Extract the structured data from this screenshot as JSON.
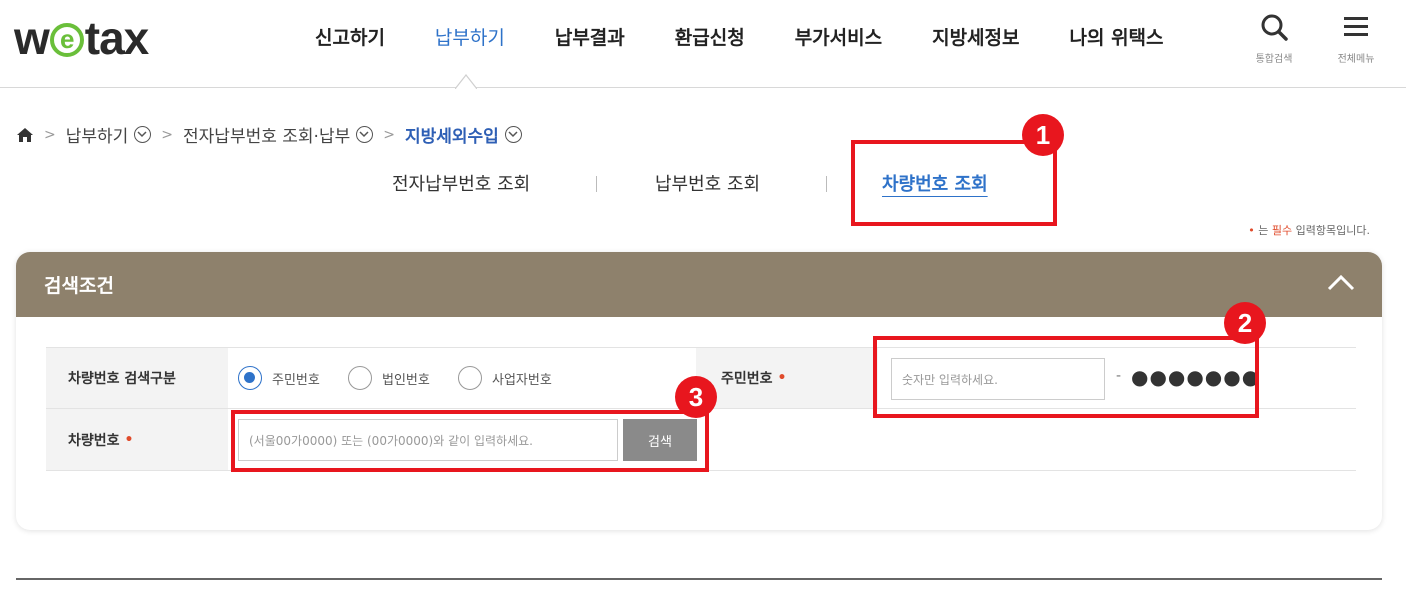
{
  "header": {
    "logo": {
      "pre": "w",
      "e": "e",
      "post": "tax"
    },
    "nav": [
      {
        "label": "신고하기",
        "active": false
      },
      {
        "label": "납부하기",
        "active": true
      },
      {
        "label": "납부결과",
        "active": false
      },
      {
        "label": "환급신청",
        "active": false
      },
      {
        "label": "부가서비스",
        "active": false
      },
      {
        "label": "지방세정보",
        "active": false
      },
      {
        "label": "나의 위택스",
        "active": false
      }
    ],
    "search_caption": "통합검색",
    "menu_caption": "전체메뉴"
  },
  "breadcrumb": {
    "items": [
      "납부하기",
      "전자납부번호 조회·납부",
      "지방세외수입"
    ]
  },
  "subtabs": [
    "전자납부번호 조회",
    "납부번호 조회",
    "차량번호 조회"
  ],
  "required_note": {
    "dot": "•",
    "pre": " 는 ",
    "em": "필수",
    "post": " 입력항목입니다."
  },
  "panel": {
    "title": "검색조건",
    "row1": {
      "label": "차량번호 검색구분",
      "radios": [
        {
          "label": "주민번호",
          "checked": true
        },
        {
          "label": "법인번호",
          "checked": false
        },
        {
          "label": "사업자번호",
          "checked": false
        }
      ],
      "id_label": "주민번호",
      "id_placeholder": "숫자만 입력하세요.",
      "dash": "-",
      "masked": "●●●●●●●"
    },
    "row2": {
      "label": "차량번호",
      "placeholder": "(서울00가0000) 또는 (00가0000)와 같이 입력하세요.",
      "search_btn": "검색"
    },
    "required_mark": "•"
  },
  "annotations": [
    "1",
    "2",
    "3"
  ],
  "colors": {
    "accent": "#2e72c9",
    "panel_header": "#8e816c",
    "annotation": "#e8161e",
    "logo_green": "#6abf3a"
  }
}
